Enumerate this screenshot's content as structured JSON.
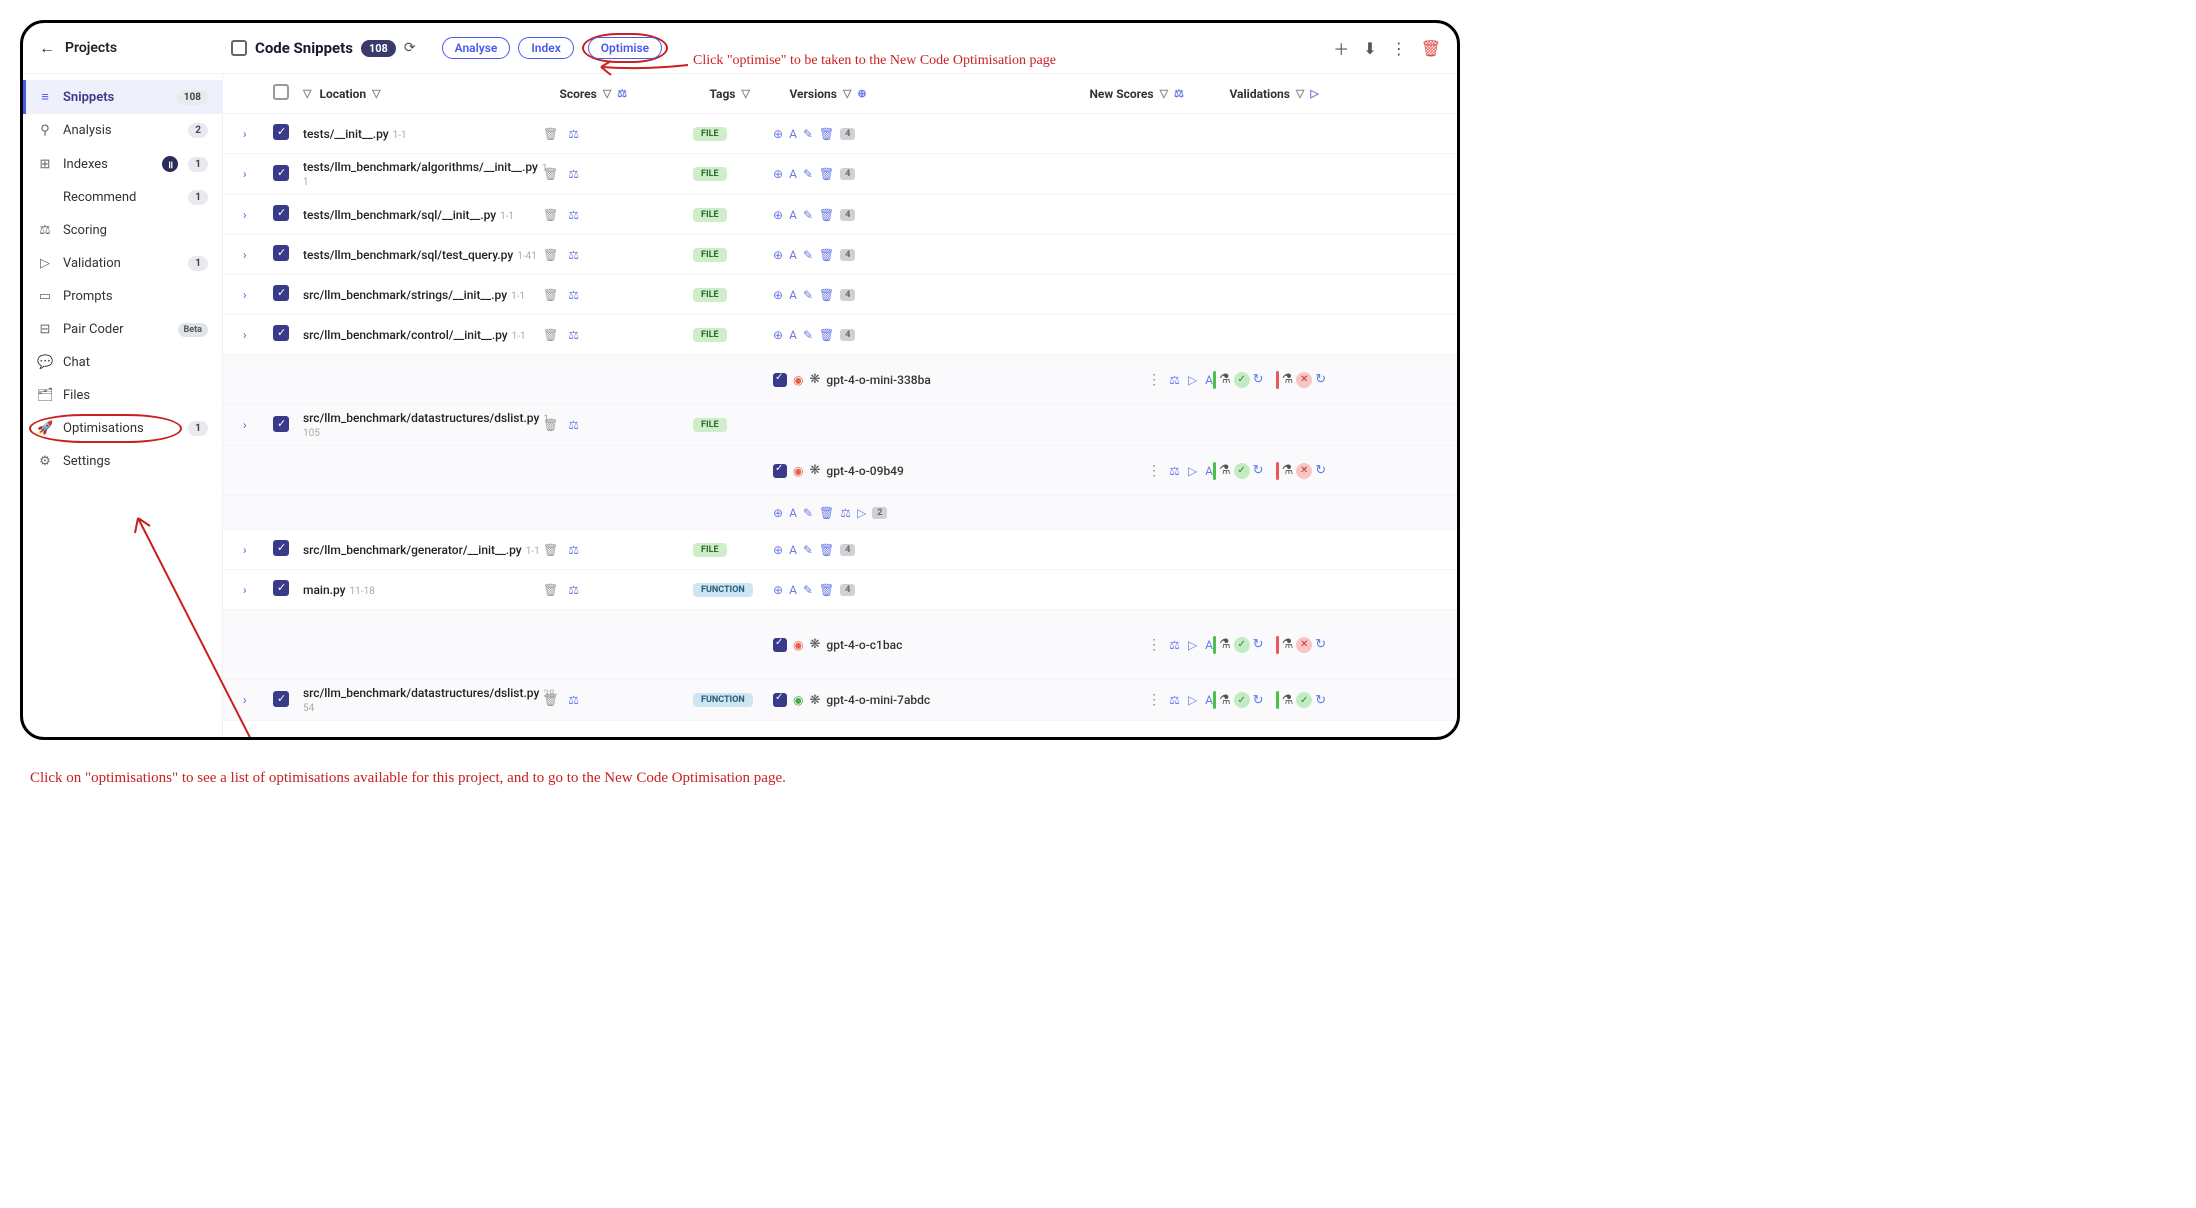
{
  "header": {
    "projects": "Projects",
    "title": "Code Snippets",
    "count": "108",
    "analyse": "Analyse",
    "index": "Index",
    "optimise": "Optimise"
  },
  "sidebar": [
    {
      "icon": "≡",
      "label": "Snippets",
      "badge": "108",
      "active": true
    },
    {
      "icon": "⚲",
      "label": "Analysis",
      "badge": "2"
    },
    {
      "icon": "⊞",
      "label": "Indexes",
      "badge": "1",
      "dot": true
    },
    {
      "icon": "</>",
      "label": "Recommend",
      "badge": "1"
    },
    {
      "icon": "⚖",
      "label": "Scoring"
    },
    {
      "icon": "▷",
      "label": "Validation",
      "badge": "1"
    },
    {
      "icon": "▭",
      "label": "Prompts"
    },
    {
      "icon": "⊟",
      "label": "Pair Coder",
      "badge": "Beta",
      "beta": true
    },
    {
      "icon": "💬",
      "label": "Chat"
    },
    {
      "icon": "🗂",
      "label": "Files"
    },
    {
      "icon": "🚀",
      "label": "Optimisations",
      "badge": "1",
      "circled": true
    },
    {
      "icon": "⚙",
      "label": "Settings"
    }
  ],
  "columns": {
    "location": "Location",
    "scores": "Scores",
    "tags": "Tags",
    "versions": "Versions",
    "newscores": "New Scores",
    "validations": "Validations"
  },
  "rows": [
    {
      "loc": "tests/__init__.py",
      "range": "1-1",
      "tag": "FILE",
      "count": "4"
    },
    {
      "loc": "tests/llm_benchmark/algorithms/__init__.py",
      "range": "1-1",
      "tag": "FILE",
      "count": "4"
    },
    {
      "loc": "tests/llm_benchmark/sql/__init__.py",
      "range": "1-1",
      "tag": "FILE",
      "count": "4"
    },
    {
      "loc": "tests/llm_benchmark/sql/test_query.py",
      "range": "1-41",
      "tag": "FILE",
      "count": "4"
    },
    {
      "loc": "src/llm_benchmark/strings/__init__.py",
      "range": "1-1",
      "tag": "FILE",
      "count": "4"
    },
    {
      "loc": "src/llm_benchmark/control/__init__.py",
      "range": "1-1",
      "tag": "FILE",
      "count": "4"
    },
    {
      "loc": "src/llm_benchmark/datastructures/dslist.py",
      "range": "1-105",
      "tag": "FILE",
      "count": "2",
      "expanded": true,
      "subs": [
        {
          "model": "gpt-4-o-mini-338ba",
          "status": "red",
          "valid1": "green",
          "valid2": "red"
        },
        {
          "model": "gpt-4-o-09b49",
          "status": "red",
          "valid1": "green",
          "valid2": "red",
          "extraicons": true
        }
      ]
    },
    {
      "loc": "src/llm_benchmark/generator/__init__.py",
      "range": "1-1",
      "tag": "FILE",
      "count": "4"
    },
    {
      "loc": "main.py",
      "range": "11-18",
      "tag": "FUNCTION",
      "count": "4"
    },
    {
      "loc": "",
      "range": "",
      "tag": "",
      "expanded": true,
      "spaceronly": true,
      "subs": [
        {
          "model": "gpt-4-o-c1bac",
          "status": "red",
          "valid1": "green",
          "valid2": "red"
        }
      ]
    },
    {
      "loc": "src/llm_benchmark/datastructures/dslist.py",
      "range": "38-54",
      "tag": "FUNCTION",
      "expanded": true,
      "subs": [
        {
          "model": "gpt-4-o-mini-7abdc",
          "status": "green",
          "valid1": "green",
          "valid2": "green",
          "inline": true
        }
      ]
    }
  ],
  "annotations": {
    "top": "Click \"optimise\" to be taken to the New Code Optimisation page",
    "bottom": "Click on \"optimisations\" to see a list of optimisations available for this project, and to go to the New Code Optimisation page."
  }
}
